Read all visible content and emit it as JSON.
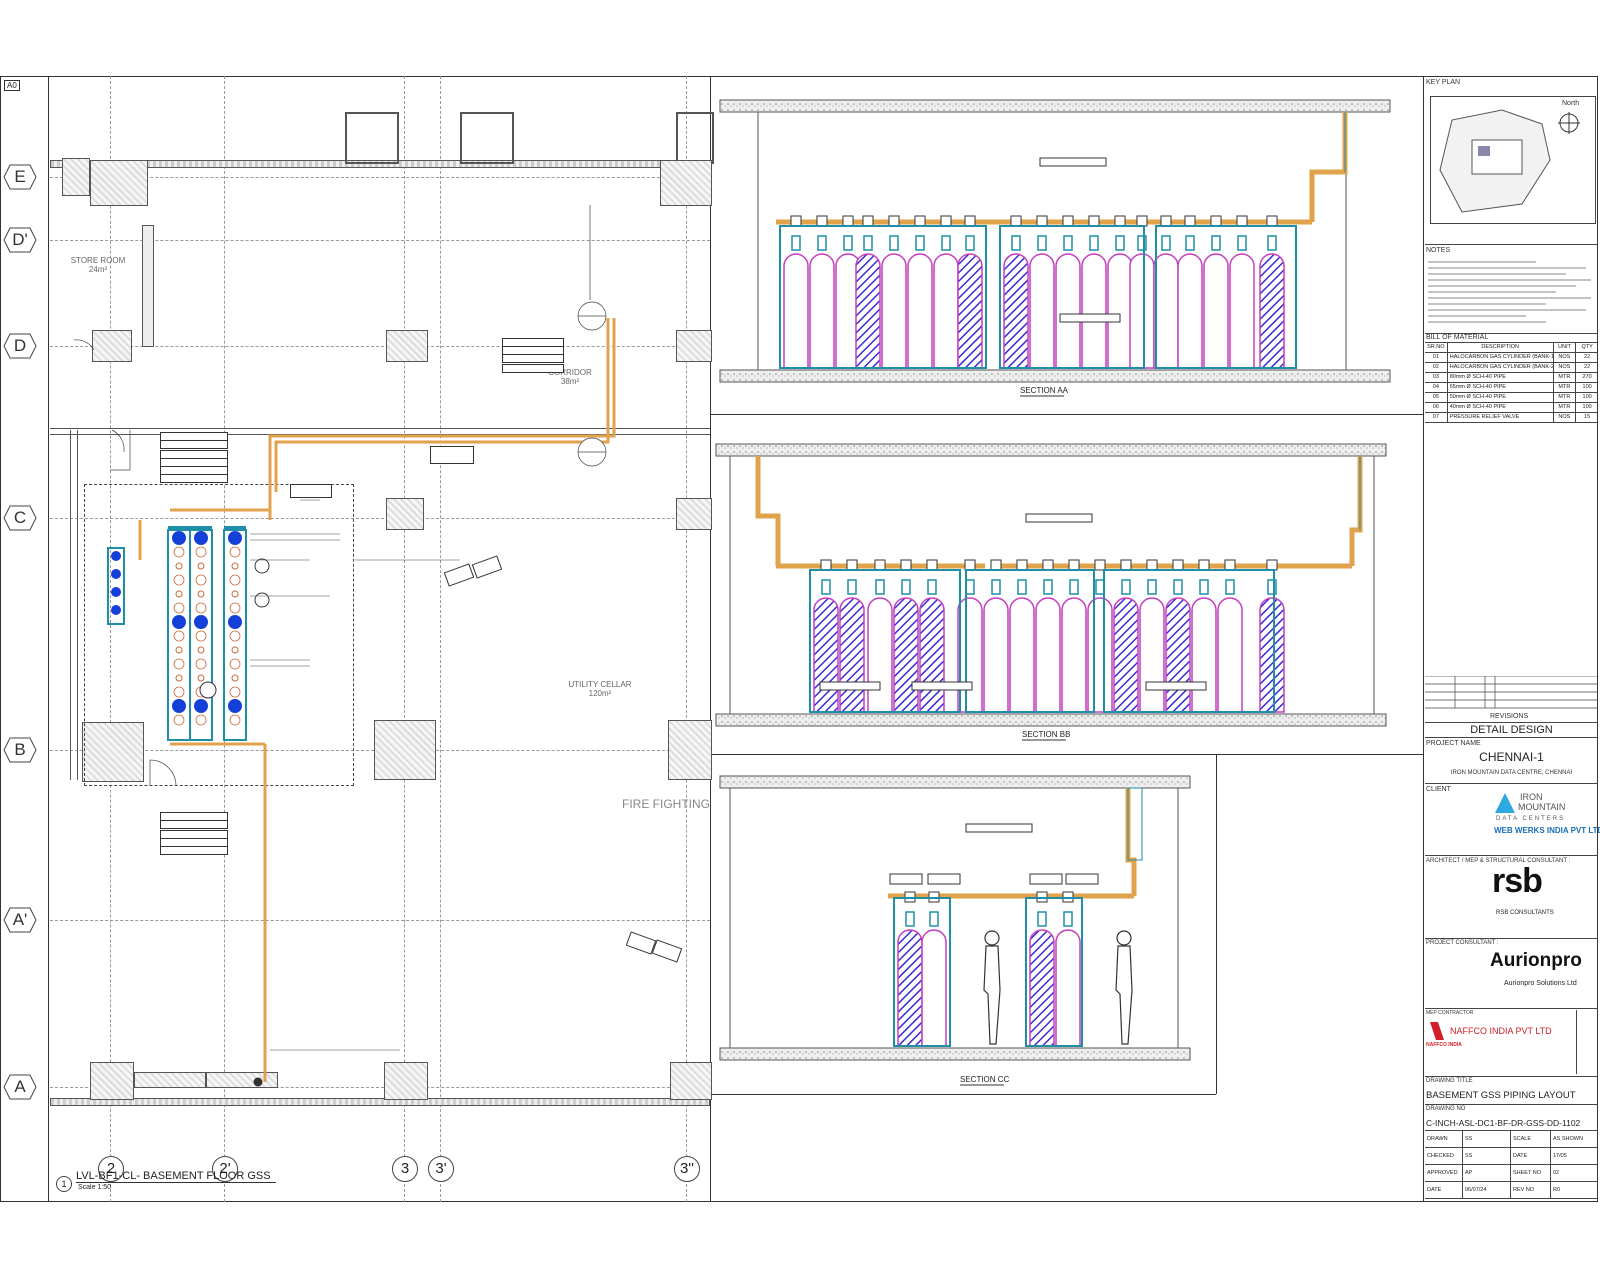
{
  "sheet_size_label": "A0",
  "grid_rows": [
    "E",
    "D'",
    "D",
    "C",
    "B",
    "A'",
    "A"
  ],
  "grid_cols": [
    "2",
    "2'",
    "3",
    "3'",
    "3''"
  ],
  "rooms": [
    {
      "name": "STORE ROOM",
      "area": "24m²"
    },
    {
      "name": "CORRIDOR",
      "area": "38m²"
    },
    {
      "name": "UTILITY CELLAR",
      "area": "120m²"
    }
  ],
  "zone_label": "FIRE FIGHTING",
  "plan_title": "LVL-BF1-CL- BASEMENT FLOOR GSS",
  "plan_number": "1",
  "plan_scale": "Scale 1:50",
  "sections": [
    {
      "label": "SECTION AA"
    },
    {
      "label": "SECTION BB"
    },
    {
      "label": "SECTION CC"
    }
  ],
  "title_block": {
    "key_plan_label": "KEY PLAN",
    "north_label": "North",
    "notes_label": "NOTES",
    "bom_label": "BILL OF MATERIAL",
    "bom_headers": [
      "SR.NO",
      "DESCRIPTION",
      "UNIT",
      "QTY"
    ],
    "bom_rows": [
      [
        "01",
        "HALOCARBON GAS CYLINDER (BANK-1)",
        "NOS",
        "22"
      ],
      [
        "02",
        "HALOCARBON GAS CYLINDER (BANK-2)",
        "NOS",
        "22"
      ],
      [
        "03",
        "80mm Ø SCH-40 PIPE",
        "MTR",
        "270"
      ],
      [
        "04",
        "65mm Ø SCH-40 PIPE",
        "MTR",
        "100"
      ],
      [
        "05",
        "50mm Ø SCH-40 PIPE",
        "MTR",
        "100"
      ],
      [
        "06",
        "40mm Ø SCH-40 PIPE",
        "MTR",
        "100"
      ],
      [
        "07",
        "PRESSURE RELIEF VALVE",
        "NOS",
        "15"
      ]
    ],
    "revisions_label": "REVISIONS",
    "stage": "DETAIL DESIGN",
    "project_name_label": "PROJECT NAME",
    "project_name": "CHENNAI-1",
    "project_sub": "IRON MOUNTAIN DATA CENTRE, CHENNAI",
    "client_label": "CLIENT",
    "client_logo_line1": "IRON",
    "client_logo_line2": "MOUNTAIN",
    "client_logo_line3": "DATA CENTERS",
    "client_name": "WEB WERKS INDIA PVT LTD",
    "architect_label": "ARCHITECT / MEP & STRUCTURAL CONSULTANT :",
    "architect_logo": "rsb",
    "architect_name": "RSB CONSULTANTS",
    "project_consultant_label": "PROJECT CONSULTANT :",
    "consultant_logo": "Aurionpro",
    "consultant_name": "Aurionpro Solutions Ltd",
    "contractor_label": "MEP CONTRACTOR",
    "contractor_name": "NAFFCO INDIA PVT LTD",
    "contractor_logo": "NAFFCO INDIA",
    "drawing_title_label": "DRAWING TITLE",
    "drawing_title": "BASEMENT GSS PIPING LAYOUT",
    "drawing_no_label": "DRAWING NO",
    "drawing_no": "C-INCH-ASL-DC1-BF-DR-GSS-DD-1102",
    "meta_rows": [
      [
        "DRAWN",
        "SS",
        "SCALE",
        "AS SHOWN"
      ],
      [
        "CHECKED",
        "SS",
        "DATE",
        "17/05"
      ],
      [
        "APPROVED",
        "AP",
        "SHEET NO",
        "02"
      ],
      [
        "DATE",
        "06/07/24",
        "REV NO",
        "R0"
      ]
    ]
  },
  "colors": {
    "pipe": "#e0a24a",
    "cylinder_outline": "#c43fbf",
    "cylinder_hatch": "#3a2ad6",
    "support": "#1e8fa6",
    "cyl_top": "#1440d8"
  }
}
